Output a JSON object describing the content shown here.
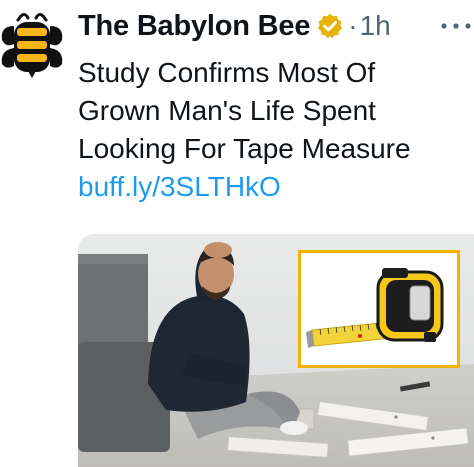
{
  "tweet": {
    "author": {
      "display_name": "The Babylon Bee",
      "verified_badge": "gold-verified-badge",
      "avatar_icon": "babylon-bee-logo-icon"
    },
    "separator": "·",
    "timestamp": "1h",
    "more_icon": "more-options-icon",
    "text_lines": [
      "Study Confirms Most Of",
      "Grown Man's Life Spent",
      "Looking For Tape Measure"
    ],
    "link": "buff.ly/3SLTHkO",
    "media": {
      "type": "photo",
      "inset_icon": "tape-measure-icon"
    }
  },
  "colors": {
    "text": "#0f1419",
    "secondary": "#536471",
    "link": "#1d9bf0",
    "badge": "#e8b20c",
    "logo_yellow": "#f7b519",
    "tape_yellow": "#f6c81a",
    "inset_border": "#f5b301"
  }
}
